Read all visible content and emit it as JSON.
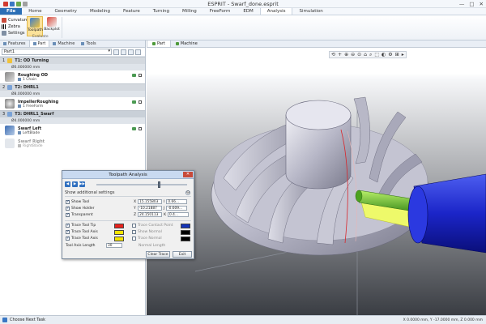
{
  "window": {
    "title": "ESPRIT - Swarf_done.esprit",
    "minimize": "—",
    "maximize": "□",
    "close": "✕"
  },
  "menu": [
    {
      "label": "File"
    },
    {
      "label": "Home"
    },
    {
      "label": "Geometry"
    },
    {
      "label": "Modeling"
    },
    {
      "label": "Feature"
    },
    {
      "label": "Turning"
    },
    {
      "label": "Milling"
    },
    {
      "label": "FreeForm"
    },
    {
      "label": "EDM"
    },
    {
      "label": "Analysis"
    },
    {
      "label": "Simulation"
    }
  ],
  "ribbon": {
    "small_items": [
      {
        "label": "Curvature",
        "icon": "curvature-icon"
      },
      {
        "label": "Zebra",
        "icon": "zebra-icon"
      },
      {
        "label": "Settings",
        "icon": "settings-icon"
      }
    ],
    "big_items": [
      {
        "label": "Toolpath",
        "icon": "toolpath-icon"
      },
      {
        "label": "Backplot",
        "icon": "backplot-icon"
      }
    ],
    "group_label": "Evaluate"
  },
  "left_panel": {
    "tabs": [
      {
        "label": "Features"
      },
      {
        "label": "Part"
      },
      {
        "label": "Machine"
      },
      {
        "label": "Tools"
      }
    ],
    "combo_value": "Part1",
    "operations": [
      {
        "kind": "head",
        "number": "1",
        "name": "T1: OD Turning",
        "sub": "Ø0.000000 mm"
      },
      {
        "kind": "row",
        "title": "Roughing OD",
        "sub": "1 Chain"
      },
      {
        "kind": "head",
        "number": "2",
        "name": "T2: DHRL1",
        "sub": "Ø8.000000 mm"
      },
      {
        "kind": "row",
        "title": "ImpellerRoughing",
        "sub": "1 FreeForm"
      },
      {
        "kind": "head",
        "number": "3",
        "name": "T3: DHRL1_Swarf",
        "sub": "Ø4.000000 mm"
      },
      {
        "kind": "row",
        "title": "Swarf Left",
        "sub": "LeftBlade"
      },
      {
        "kind": "row-dim",
        "title": "Swarf Right",
        "sub": "RightBlade"
      }
    ]
  },
  "viewport": {
    "tabs": [
      {
        "label": "Part"
      },
      {
        "label": "Machine"
      }
    ],
    "toolbar": [
      "⟲",
      "+",
      "⊕",
      "⊖",
      "⊙",
      "⌂",
      "⌕",
      "⬚",
      "◐",
      "⚙",
      "⊞",
      "▸"
    ]
  },
  "dialog": {
    "title": "Toolpath Analysis",
    "close": "✕",
    "play": [
      "◀",
      "▶",
      "▶▶"
    ],
    "slider_fraction": 0.68,
    "additional": "Show additional settings",
    "additional_btn": "⊖",
    "checks_left": [
      {
        "label": "Show Tool",
        "on": true
      },
      {
        "label": "Show Holder",
        "on": true
      },
      {
        "label": "Transparent",
        "on": true
      }
    ],
    "coords": [
      {
        "axis": "X",
        "value": "15.155803",
        "dir": "I",
        "dir_value": "0.66..."
      },
      {
        "axis": "Y",
        "value": "-10.21887",
        "dir": "J",
        "dir_value": "-0.609..."
      },
      {
        "axis": "Z",
        "value": "24.150113",
        "dir": "K",
        "dir_value": "0.4..."
      }
    ],
    "coord_dirs": [
      "0.66...",
      "-0.609...",
      "0.4..."
    ],
    "trace": [
      {
        "label": "Trace Tool Tip",
        "on": true,
        "color": "#e8221c"
      },
      {
        "label": "Trace Tool Axis",
        "on": true,
        "color": "#f5e400"
      },
      {
        "label": "Trace Tool Axis",
        "on": true,
        "color": "#f5e400"
      }
    ],
    "trace_right": [
      {
        "label": "Trace Contact Point",
        "color": "#1434b8"
      },
      {
        "label": "Show Normal",
        "color": "#000000"
      },
      {
        "label": "Trace Normal",
        "color": "#000000"
      }
    ],
    "tool_axis_length_label": "Tool Axis Length",
    "tool_axis_length_value": "30",
    "normal_length_label": "Normal Length",
    "clear_trace": "Clear Trace",
    "exit": "Exit"
  },
  "status": {
    "next": "Choose Next Task",
    "coords": "X 0.0000 mm, Y -17.0000 mm, Z 0.000 mm"
  }
}
